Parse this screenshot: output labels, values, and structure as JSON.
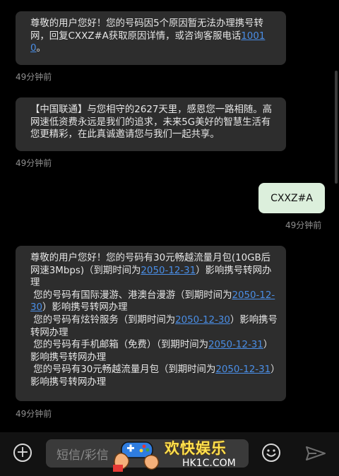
{
  "messages": {
    "m1": {
      "text": "尊敬的用户您好！您的号码因5个原因暂无法办理携号转网，回复CXXZ#A获取原因详情，或咨询客服电话",
      "phone": "10010",
      "end": "。",
      "time": "49分钟前"
    },
    "m2": {
      "text": "【中国联通】与您相守的2627天里，感恩您一路相随。高网速低资费永远是我们的追求，未来5G美好的智慧生活有您更精彩，在此真诚邀请您与我们一起共享。",
      "time": "49分钟前"
    },
    "sent": {
      "text": "CXXZ#A",
      "time": "49分钟前"
    },
    "m3": {
      "p1": "尊敬的用户您好！您的号码有30元畅越流量月包(10GB后网速3Mbps)（到期时间为",
      "d1": "2050-12-31",
      "p2": "）影响携号转网办理\n 您的号码有国际漫游、港澳台漫游（到期时间为",
      "d2": "2050-12-30",
      "p3": "）影响携号转网办理\n 您的号码有炫铃服务（到期时间为",
      "d3": "2050-12-30",
      "p4": "）影响携号转网办理\n 您的号码有手机邮箱（免费）（到期时间为",
      "d4": "2050-12-31",
      "p5": "）影响携号转网办理\n 您的号码有30元畅越流量月包（到期时间为",
      "d5": "2050-12-31",
      "p6": "）影响携号转网办理",
      "time": "49分钟前"
    }
  },
  "composer": {
    "add_icon": "plus-circle-icon",
    "placeholder": "短信/彩信",
    "emoji_icon": "smiley-icon",
    "send_icon": "send-arrow-icon"
  },
  "watermark": {
    "title": "欢快娱乐",
    "domain": "HK1C.COM"
  }
}
